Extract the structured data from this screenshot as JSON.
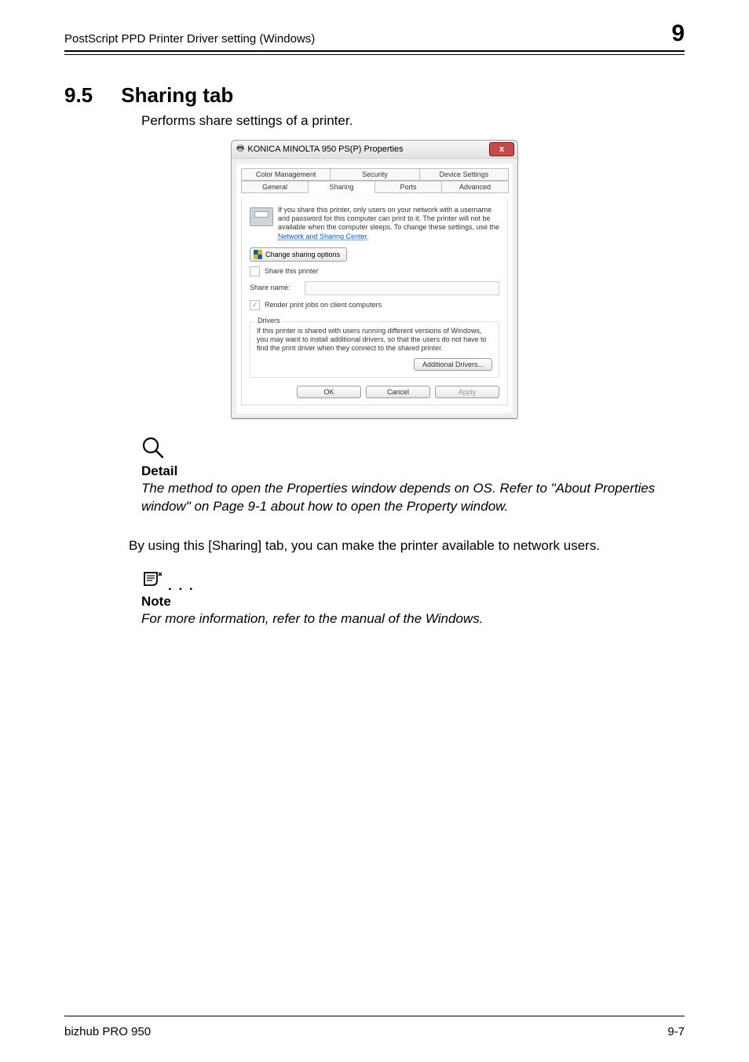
{
  "header": {
    "running_title": "PostScript PPD Printer Driver setting (Windows)",
    "chapter_number": "9"
  },
  "section": {
    "number": "9.5",
    "title": "Sharing tab",
    "intro": "Performs share settings of a printer."
  },
  "dialog": {
    "title": "KONICA MINOLTA 950 PS(P) Properties",
    "close_glyph": "x",
    "tabs_row1": [
      "Color Management",
      "Security",
      "Device Settings"
    ],
    "tabs_row2": [
      "General",
      "Sharing",
      "Ports",
      "Advanced"
    ],
    "active_tab_index": 1,
    "info_text": "If you share this printer, only users on your network with a username and password for this computer can print to it. The printer will not be available when the computer sleeps. To change these settings, use the ",
    "info_link": "Network and Sharing Center",
    "change_sharing": "Change sharing options",
    "share_this_printer": "Share this printer",
    "share_name_label": "Share name:",
    "render_jobs": "Render print jobs on client computers",
    "drivers_group": "Drivers",
    "drivers_text": "If this printer is shared with users running different versions of Windows, you may want to install additional drivers, so that the users do not have to find the print driver when they connect to the shared printer.",
    "additional_drivers": "Additional Drivers...",
    "ok": "OK",
    "cancel": "Cancel",
    "apply": "Apply"
  },
  "detail": {
    "heading": "Detail",
    "text": "The method to open the Properties window depends on OS. Refer to \"About Properties window\" on Page 9-1 about how to open the Property window."
  },
  "middle_paragraph": "By using this [Sharing] tab, you can make the printer available to network users.",
  "note": {
    "heading": "Note",
    "dots": ". . .",
    "text": "For more information, refer to the manual of the Windows."
  },
  "footer": {
    "left": "bizhub PRO 950",
    "right": "9-7"
  }
}
